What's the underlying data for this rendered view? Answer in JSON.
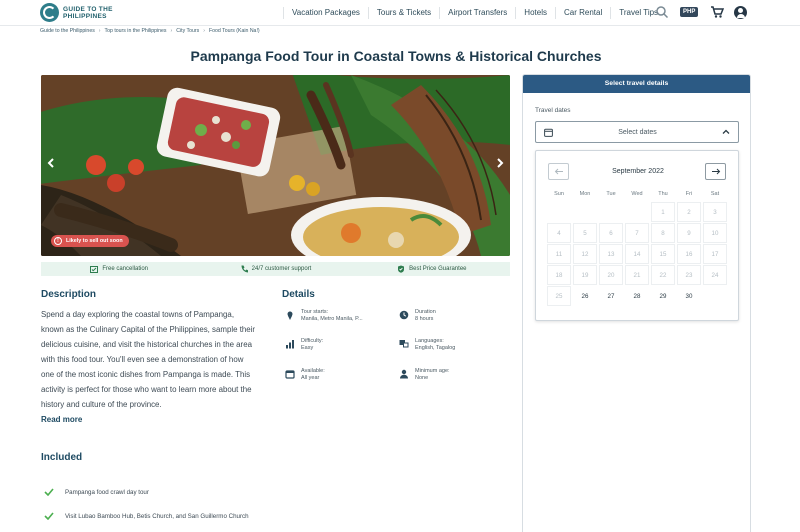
{
  "header": {
    "logo_line1": "GUIDE TO THE",
    "logo_line2": "PHILIPPINES",
    "nav": [
      "Vacation Packages",
      "Tours & Tickets",
      "Airport Transfers",
      "Hotels",
      "Car Rental",
      "Travel Tips"
    ],
    "currency": "PHP"
  },
  "breadcrumb": [
    "Guide to the Philippines",
    "Top tours in the Philippines",
    "City Tours",
    "Food Tours (Kain Na!)"
  ],
  "title": "Pampanga Food Tour in Coastal Towns & Historical Churches",
  "hero": {
    "badge": "Likely to sell out soon"
  },
  "trust": [
    "Free cancellation",
    "24/7 customer support",
    "Best Price Guarantee"
  ],
  "description": {
    "heading": "Description",
    "lines": [
      "Spend a day exploring the coastal towns of Pampanga,",
      "known as the Culinary Capital of the Philippines, sample their",
      "delicious cuisine, and visit the historical churches in the area",
      "with this food tour. You'll even see a demonstration of how",
      "one of the most iconic dishes from Pampanga is made. This",
      "activity is perfect for those who want to learn more about the",
      "history and culture of the province."
    ],
    "read_more": "Read more"
  },
  "details": {
    "heading": "Details",
    "items": [
      {
        "label": "Tour starts:",
        "value": "Manila, Metro Manila, P...",
        "icon": "map-pin-icon"
      },
      {
        "label": "Duration",
        "value": "8 hours",
        "icon": "clock-icon"
      },
      {
        "label": "Difficulty:",
        "value": "Easy",
        "icon": "bar-chart-icon"
      },
      {
        "label": "Languages:",
        "value": "English, Tagalog",
        "icon": "language-icon"
      },
      {
        "label": "Available:",
        "value": "All year",
        "icon": "calendar-icon"
      },
      {
        "label": "Minimum age:",
        "value": "None",
        "icon": "user-icon"
      }
    ]
  },
  "included": {
    "heading": "Included",
    "items": [
      "Pampanga food crawl day tour",
      "Visit Lubao Bamboo Hub, Betis Church, and San Guillermo Church"
    ]
  },
  "booking": {
    "header": "Select travel details",
    "dates_label": "Travel dates",
    "select_placeholder": "Select dates",
    "calendar": {
      "month": "September 2022",
      "weekdays": [
        "Sun",
        "Mon",
        "Tue",
        "Wed",
        "Thu",
        "Fri",
        "Sat"
      ],
      "first_weekday": 4,
      "days_in_month": 30,
      "first_available_day": 26
    }
  },
  "colors": {
    "brand": "#2c5a84",
    "heading": "#1e3a4c",
    "trust_bg": "#e8f4ee",
    "badge": "#d9534f",
    "check": "#4caf50"
  }
}
